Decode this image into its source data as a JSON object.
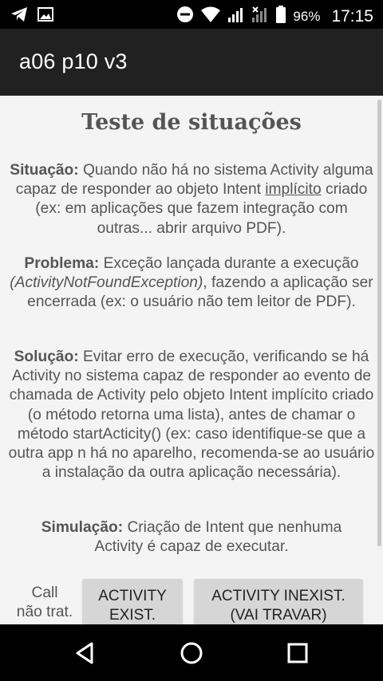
{
  "status_bar": {
    "battery": "96%",
    "time": "17:15",
    "icons": [
      "telegram-icon",
      "gallery-icon",
      "do-not-disturb-icon",
      "wifi-icon",
      "signal-icon",
      "signal-x-icon",
      "battery-icon"
    ]
  },
  "app_bar": {
    "title": "a06 p10 v3"
  },
  "main": {
    "title": "Teste de situações",
    "situacao": {
      "label": "Situação:",
      "text1": " Quando não há no sistema Activity alguma capaz de responder ao objeto Intent ",
      "underlined": "implícito",
      "text2": " criado (ex: em aplicações que fazem integração com outras... abrir arquivo PDF)."
    },
    "problema": {
      "label": "Problema:",
      "text1": " Exceção lançada durante a execução ",
      "italic": "(ActivityNotFoundException)",
      "text2": ", fazendo a aplicação ser encerrada (ex: o usuário não tem leitor de PDF)."
    },
    "solucao": {
      "label": "Solução:",
      "text": " Evitar erro de execução, verificando se há Activity no sistema capaz de responder ao evento de chamada de Activity pelo objeto Intent implícito criado (o método retorna uma lista), antes de chamar o método startActicity() (ex: caso identifique-se que a outra app n há no aparelho, recomenda-se ao usuário a instalação da outra aplicação necessária)."
    },
    "simulacao": {
      "label": "Simulação:",
      "text": " Criação de Intent que nenhuma Activity é capaz de executar."
    },
    "bottom_label": "Call\nnão trat.",
    "buttons": {
      "exist": "ACTIVITY\nEXIST.",
      "inexist": "ACTIVITY INEXIST.\n(VAI TRAVAR)"
    }
  },
  "nav_bar": {
    "icons": [
      "back-icon",
      "home-icon",
      "recents-icon"
    ]
  }
}
